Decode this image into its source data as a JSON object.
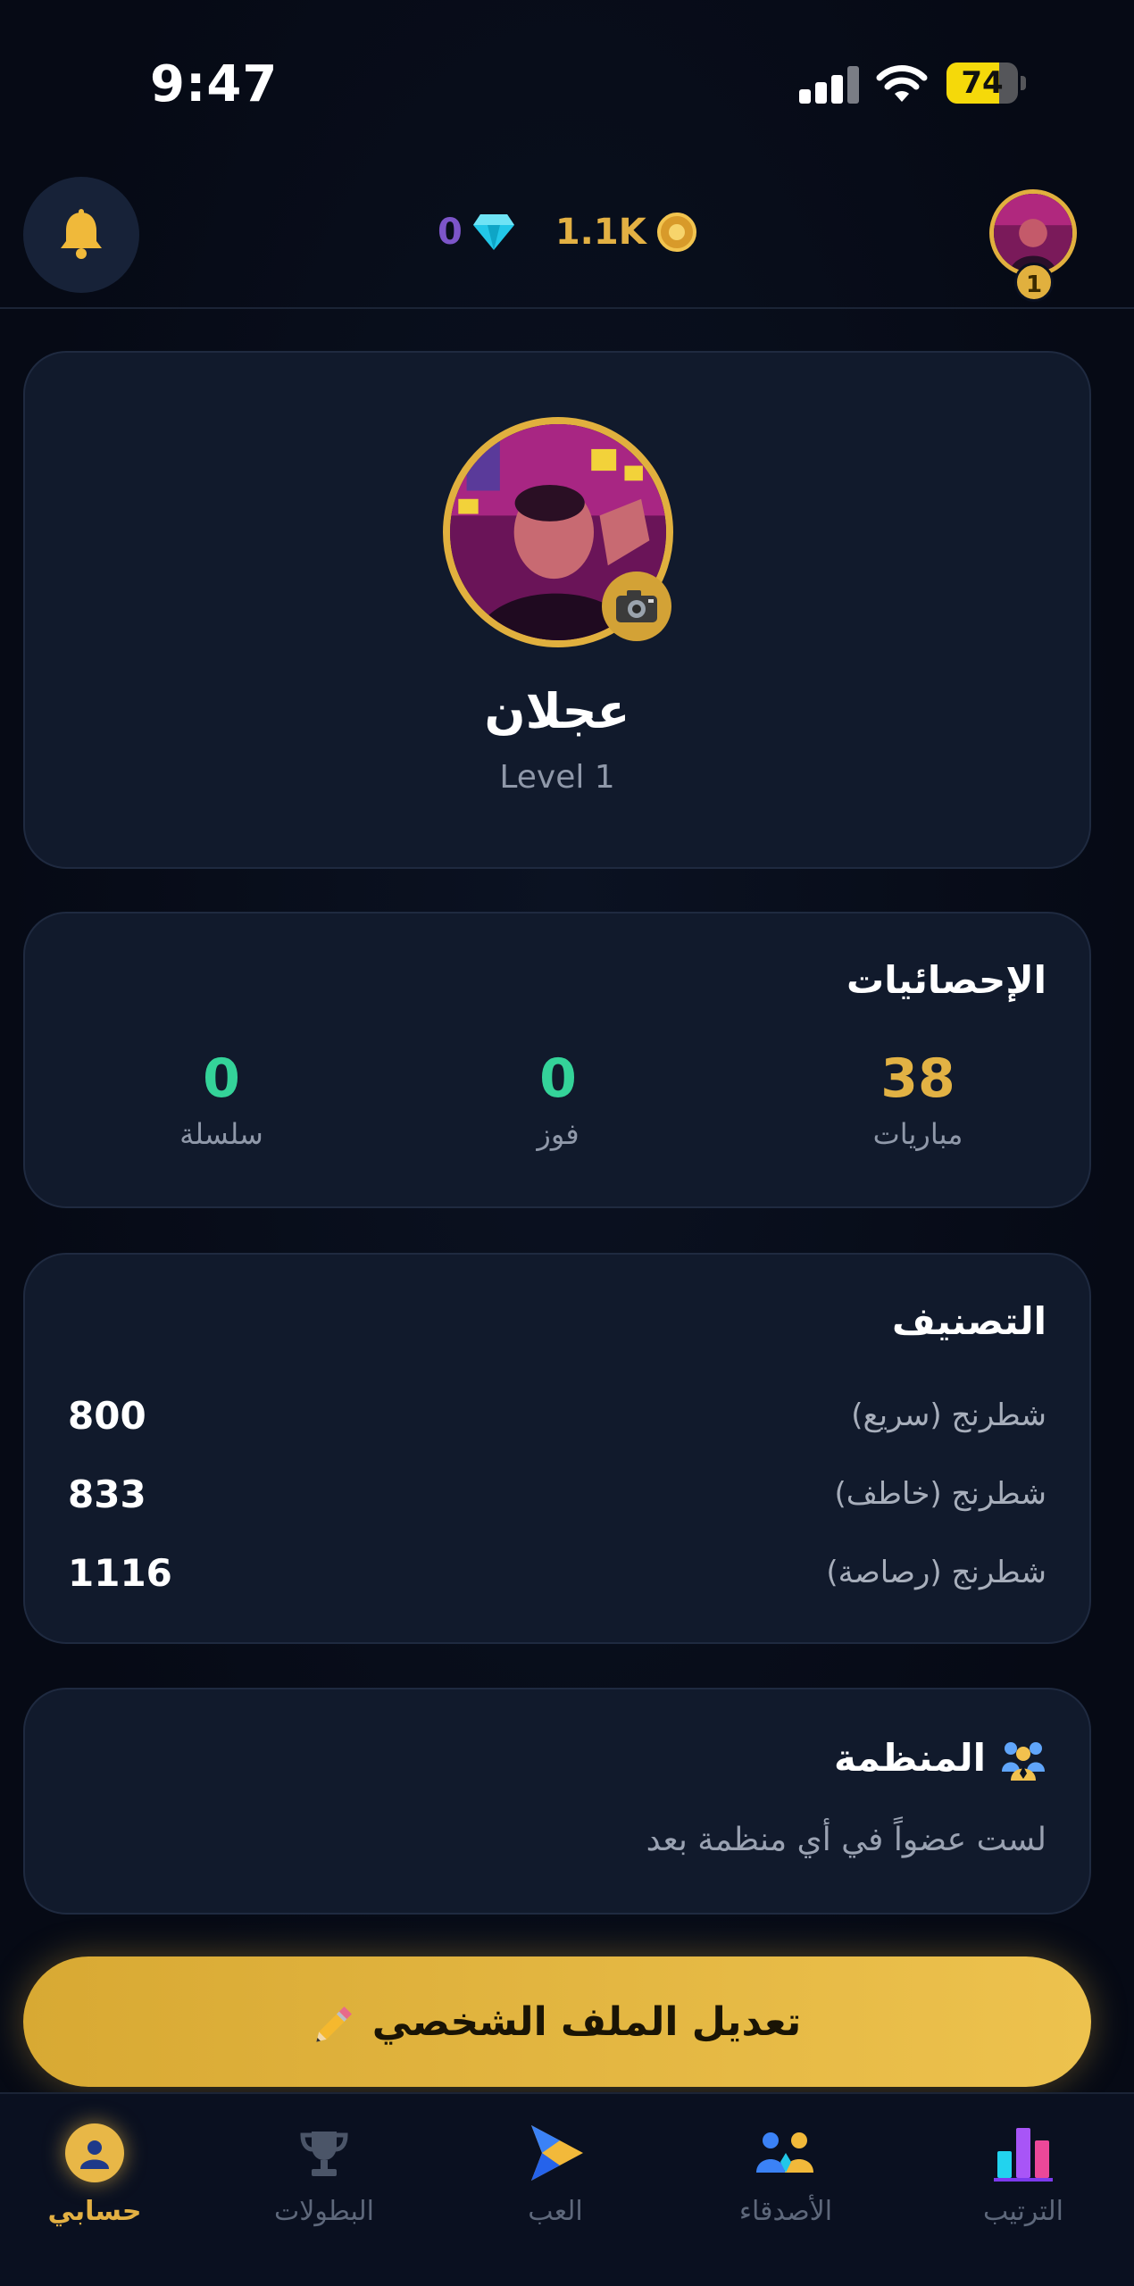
{
  "status_bar": {
    "time": "9:47",
    "battery": "74",
    "battery_level": 0.74
  },
  "header": {
    "gems": "0",
    "coins": "1.1K",
    "level_badge": "1"
  },
  "profile": {
    "name": "عجلان",
    "level": "Level 1"
  },
  "stats": {
    "title": "الإحصائيات",
    "items": [
      {
        "label": "مباريات",
        "value": "38",
        "color": "#e2b244"
      },
      {
        "label": "فوز",
        "value": "0",
        "color": "#34d399"
      },
      {
        "label": "سلسلة",
        "value": "0",
        "color": "#34d399"
      }
    ]
  },
  "rating": {
    "title": "التصنيف",
    "rows": [
      {
        "label": "شطرنج (سريع)",
        "value": "800"
      },
      {
        "label": "شطرنج (خاطف)",
        "value": "833"
      },
      {
        "label": "شطرنج (رصاصة)",
        "value": "1116"
      }
    ]
  },
  "organization": {
    "title": "المنظمة",
    "subtitle": "لست عضواً في أي منظمة بعد"
  },
  "edit_button": {
    "label": "تعديل الملف الشخصي"
  },
  "nav": {
    "items": [
      {
        "label": "حسابي",
        "active": true
      },
      {
        "label": "البطولات",
        "active": false
      },
      {
        "label": "العب",
        "active": false
      },
      {
        "label": "الأصدقاء",
        "active": false
      },
      {
        "label": "الترتيب",
        "active": false
      }
    ]
  },
  "colors": {
    "accent": "#e1b03e",
    "background": "#070c18",
    "card": "#111a2c",
    "gem": "#7c55c9"
  }
}
